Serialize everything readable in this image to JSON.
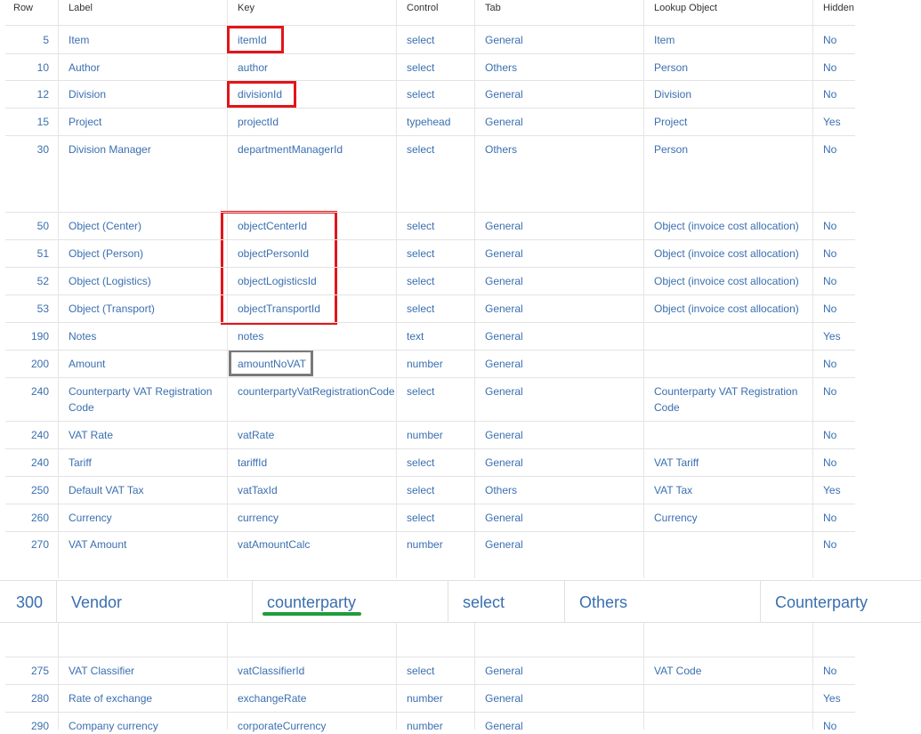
{
  "headers": {
    "row": "Row",
    "label": "Label",
    "key": "Key",
    "control": "Control",
    "tab": "Tab",
    "lookup": "Lookup Object",
    "hidden": "Hidden"
  },
  "rows": [
    {
      "row": "5",
      "label": "Item",
      "key": "itemId",
      "control": "select",
      "tab": "General",
      "lookup": "Item",
      "hidden": "No"
    },
    {
      "row": "10",
      "label": "Author",
      "key": "author",
      "control": "select",
      "tab": "Others",
      "lookup": "Person",
      "hidden": "No"
    },
    {
      "row": "12",
      "label": "Division",
      "key": "divisionId",
      "control": "select",
      "tab": "General",
      "lookup": "Division",
      "hidden": "No"
    },
    {
      "row": "15",
      "label": "Project",
      "key": "projectId",
      "control": "typehead",
      "tab": "General",
      "lookup": "Project",
      "hidden": "Yes"
    },
    {
      "row": "30",
      "label": "Division Manager",
      "key": "departmentManagerId",
      "control": "select",
      "tab": "Others",
      "lookup": "Person",
      "hidden": "No"
    },
    {
      "row": "50",
      "label": "Object (Center)",
      "key": "objectCenterId",
      "control": "select",
      "tab": "General",
      "lookup": "Object (invoice cost allocation)",
      "hidden": "No"
    },
    {
      "row": "51",
      "label": "Object (Person)",
      "key": "objectPersonId",
      "control": "select",
      "tab": "General",
      "lookup": "Object (invoice cost allocation)",
      "hidden": "No"
    },
    {
      "row": "52",
      "label": "Object (Logistics)",
      "key": "objectLogisticsId",
      "control": "select",
      "tab": "General",
      "lookup": "Object (invoice cost allocation)",
      "hidden": "No"
    },
    {
      "row": "53",
      "label": "Object (Transport)",
      "key": "objectTransportId",
      "control": "select",
      "tab": "General",
      "lookup": "Object (invoice cost allocation)",
      "hidden": "No"
    },
    {
      "row": "190",
      "label": "Notes",
      "key": "notes",
      "control": "text",
      "tab": "General",
      "lookup": "",
      "hidden": "Yes"
    },
    {
      "row": "200",
      "label": "Amount",
      "key": "amountNoVAT",
      "control": "number",
      "tab": "General",
      "lookup": "",
      "hidden": "No"
    },
    {
      "row": "240",
      "label": "Counterparty VAT Registration Code",
      "key": "counterpartyVatRegistrationCode",
      "control": "select",
      "tab": "General",
      "lookup": "Counterparty VAT Registration Code",
      "hidden": "No"
    },
    {
      "row": "240",
      "label": "VAT Rate",
      "key": "vatRate",
      "control": "number",
      "tab": "General",
      "lookup": "",
      "hidden": "No"
    },
    {
      "row": "240",
      "label": "Tariff",
      "key": "tariffId",
      "control": "select",
      "tab": "General",
      "lookup": "VAT Tariff",
      "hidden": "No"
    },
    {
      "row": "250",
      "label": "Default VAT Tax",
      "key": "vatTaxId",
      "control": "select",
      "tab": "Others",
      "lookup": "VAT Tax",
      "hidden": "Yes"
    },
    {
      "row": "260",
      "label": "Currency",
      "key": "currency",
      "control": "select",
      "tab": "General",
      "lookup": "Currency",
      "hidden": "No"
    },
    {
      "row": "270",
      "label": "VAT Amount",
      "key": "vatAmountCalc",
      "control": "number",
      "tab": "General",
      "lookup": "",
      "hidden": "No"
    },
    {
      "row": "275",
      "label": "VAT Classifier",
      "key": "vatClassifierId",
      "control": "select",
      "tab": "General",
      "lookup": "VAT Code",
      "hidden": "No"
    },
    {
      "row": "280",
      "label": "Rate of exchange",
      "key": "exchangeRate",
      "control": "number",
      "tab": "General",
      "lookup": "",
      "hidden": "Yes"
    },
    {
      "row": "290",
      "label": "Company currency",
      "key": "corporateCurrency",
      "control": "number",
      "tab": "General",
      "lookup": "",
      "hidden": "No"
    }
  ],
  "zoomed_row": {
    "row": "300",
    "label": "Vendor",
    "key": "counterparty",
    "control": "select",
    "tab": "Others",
    "lookup": "Counterparty"
  },
  "colors": {
    "link": "#3a6fb0",
    "highlight_red": "#e3151a",
    "highlight_gray": "#7a7a7a",
    "highlight_green": "#1f9d3a"
  }
}
